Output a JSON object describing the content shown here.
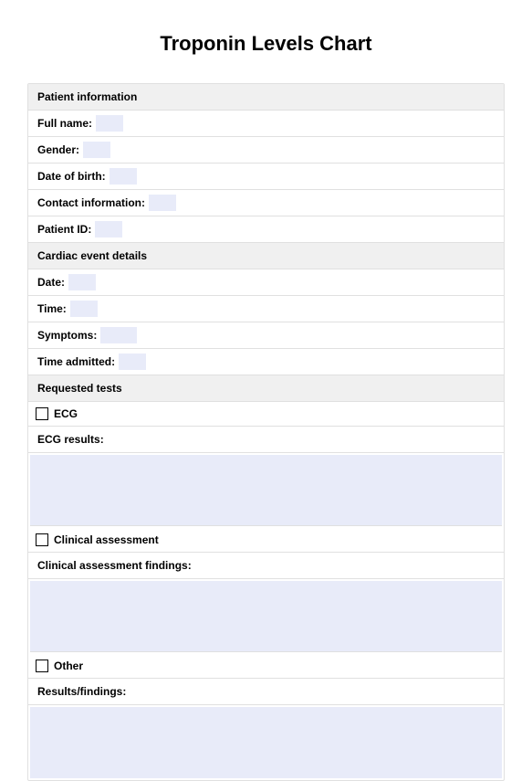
{
  "title": "Troponin Levels Chart",
  "sections": {
    "patient_info": {
      "header": "Patient information",
      "fields": {
        "full_name": "Full name:",
        "gender": "Gender:",
        "dob": "Date of birth:",
        "contact": "Contact information:",
        "patient_id": "Patient ID:"
      }
    },
    "cardiac_event": {
      "header": "Cardiac event details",
      "fields": {
        "date": "Date:",
        "time": "Time:",
        "symptoms": "Symptoms:",
        "time_admitted": "Time admitted:"
      }
    },
    "requested_tests": {
      "header": "Requested tests",
      "tests": {
        "ecg": {
          "label": "ECG",
          "results_label": "ECG results:"
        },
        "clinical": {
          "label": "Clinical assessment",
          "results_label": "Clinical assessment findings:"
        },
        "other": {
          "label": "Other",
          "results_label": "Results/findings:"
        }
      }
    }
  }
}
